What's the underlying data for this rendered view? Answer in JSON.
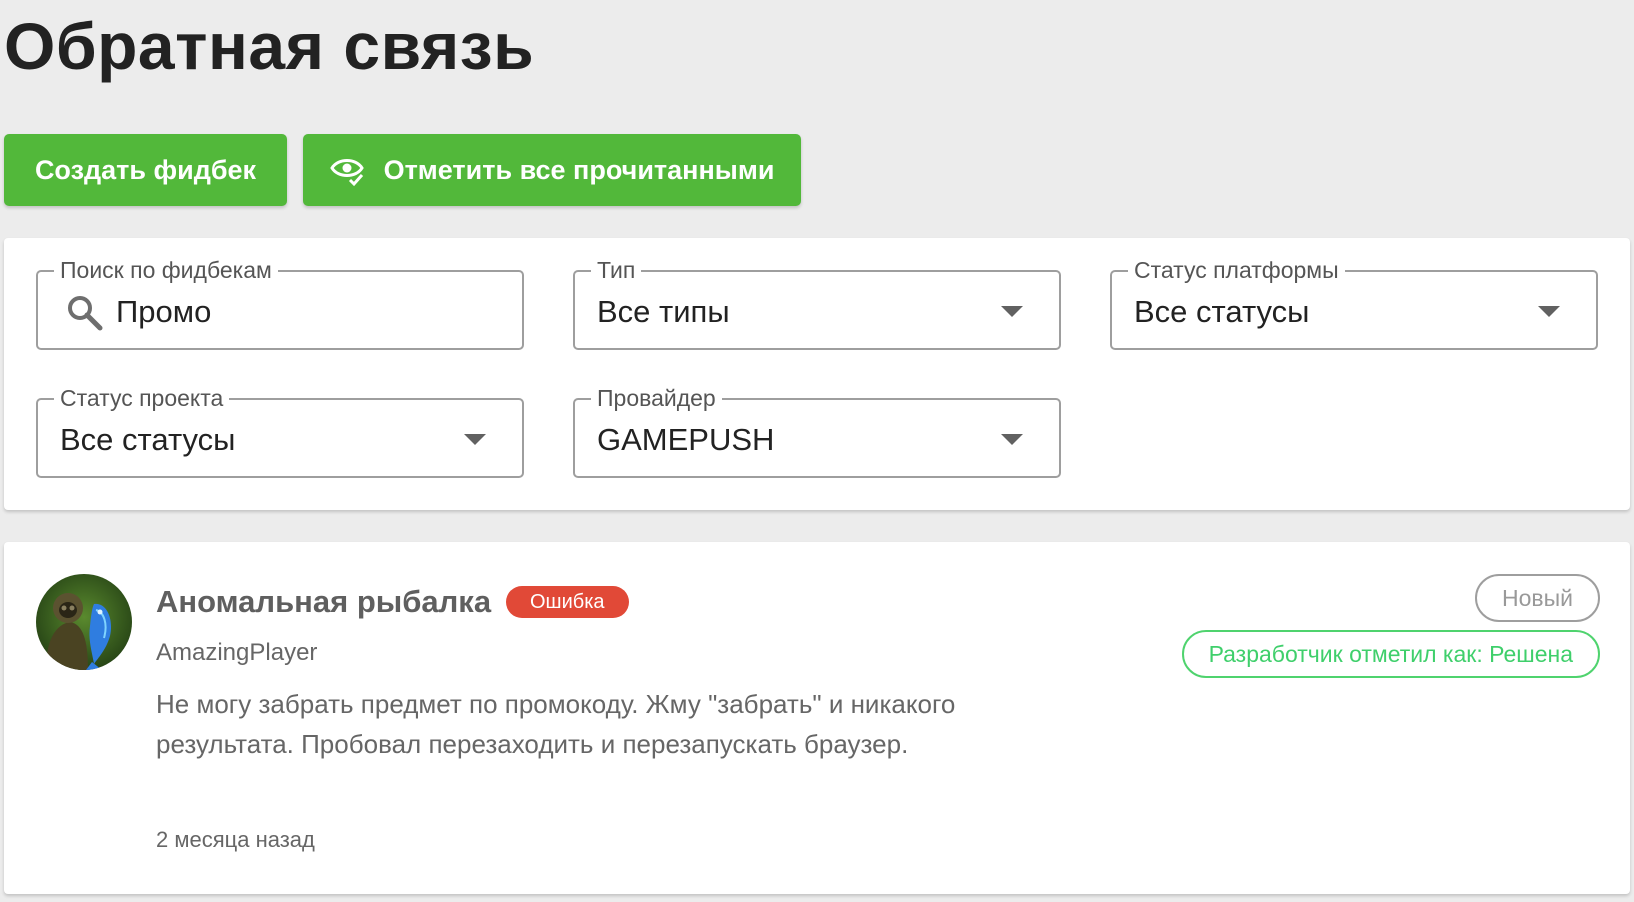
{
  "page": {
    "title": "Обратная связь"
  },
  "toolbar": {
    "create_label": "Создать фидбек",
    "mark_read_label": "Отметить все прочитанными",
    "mark_read_icon": "eye-check-icon",
    "accent_color": "#52b83a"
  },
  "filters": {
    "search": {
      "label": "Поиск по фидбекам",
      "value": "Промо",
      "icon": "search-icon"
    },
    "type": {
      "label": "Тип",
      "value": "Все типы"
    },
    "platform_status": {
      "label": "Статус платформы",
      "value": "Все статусы"
    },
    "project_status": {
      "label": "Статус проекта",
      "value": "Все статусы"
    },
    "provider": {
      "label": "Провайдер",
      "value": "GAMEPUSH"
    }
  },
  "feedback": [
    {
      "title": "Аномальная рыбалка",
      "type_badge": "Ошибка",
      "type_badge_color": "#e14937",
      "author": "AmazingPlayer",
      "text": "Не могу забрать предмет по промокоду. Жму \"забрать\" и никакого результата. Пробовал перезаходить и перезапускать браузер.",
      "time": "2 месяца назад",
      "status": "Новый",
      "developer_status": "Разработчик отметил как: Решена",
      "developer_status_color": "#4fd36e"
    }
  ]
}
